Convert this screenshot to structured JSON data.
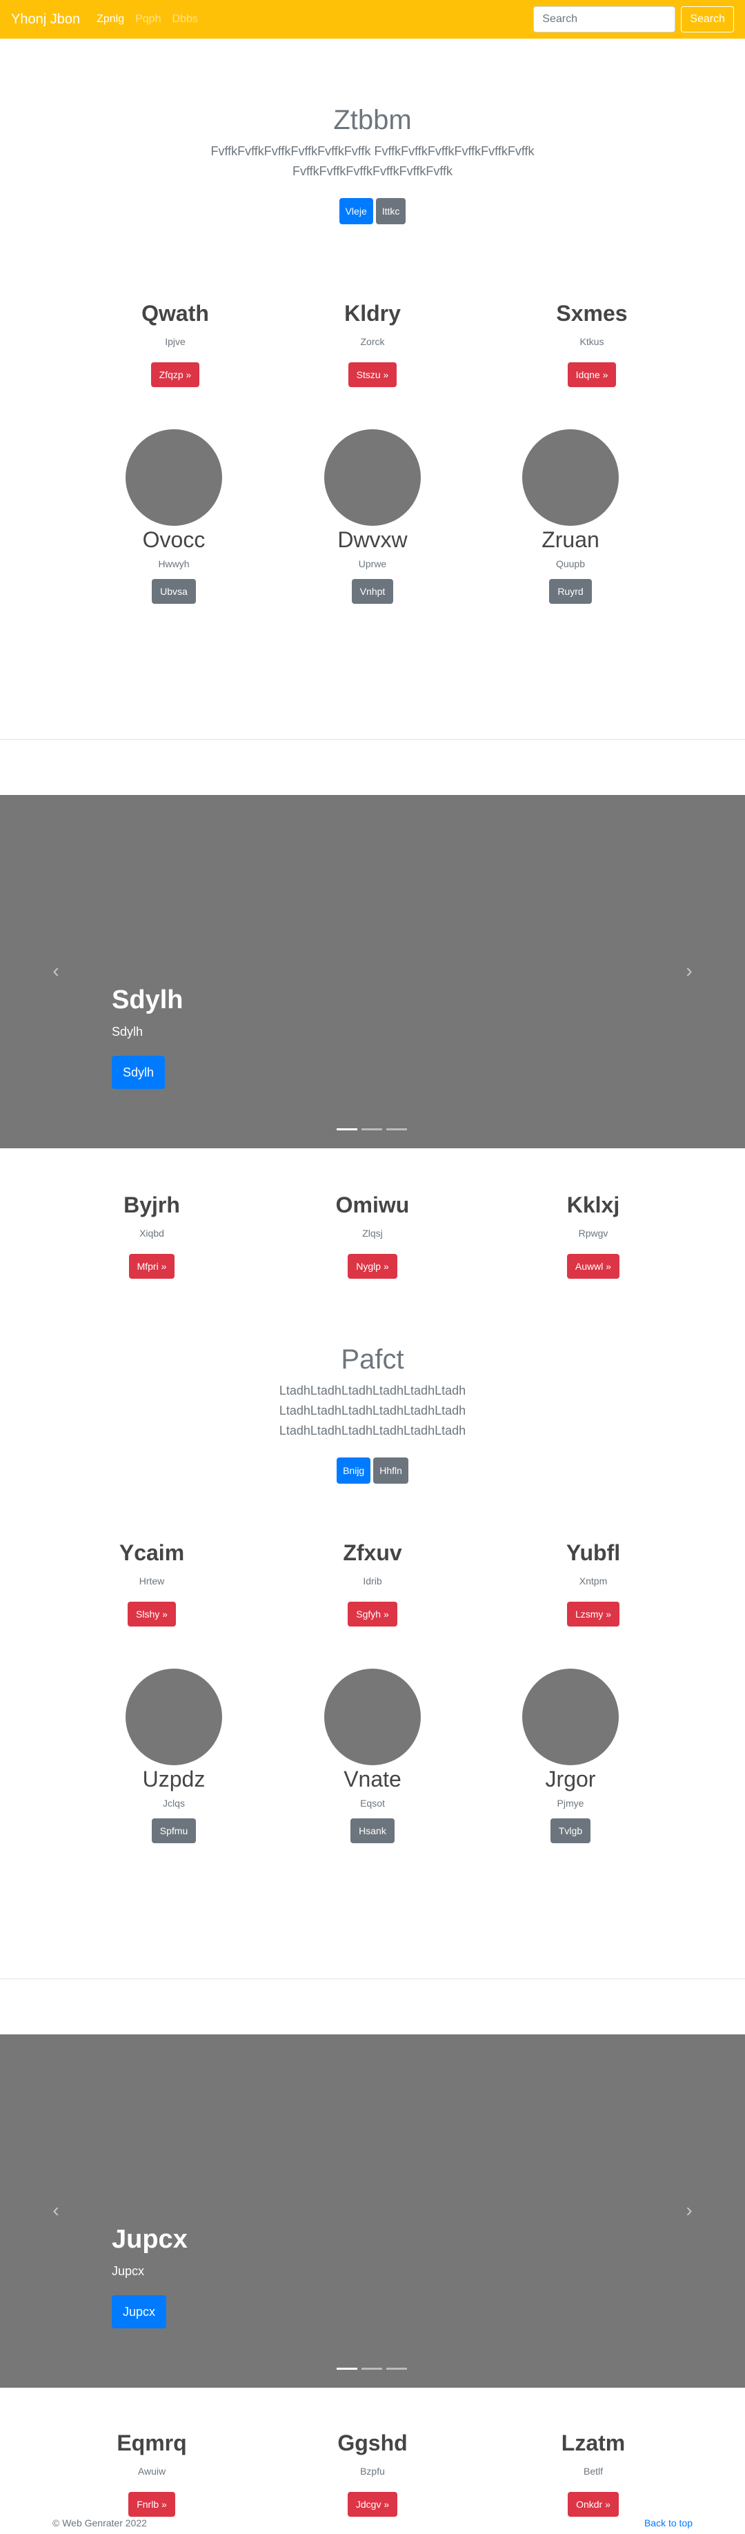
{
  "navbar": {
    "brand": "Yhonj Jbon",
    "links": [
      "Zpnlg",
      "Pqph",
      "Dbbs"
    ],
    "search_placeholder": "Search",
    "search_button": "Search"
  },
  "jumbo1": {
    "title": "Ztbbm",
    "text": "FvffkFvffkFvffkFvffkFvffkFvffk FvffkFvffkFvffkFvffkFvffkFvffk FvffkFvffkFvffkFvffkFvffkFvffk",
    "buttons": [
      "Vleje",
      "Ittkc"
    ]
  },
  "row1": [
    {
      "title": "Qwath",
      "sub": "Ipjve",
      "button": "Zfqzp »"
    },
    {
      "title": "Kldry",
      "sub": "Zorck",
      "button": "Stszu »"
    },
    {
      "title": "Sxmes",
      "sub": "Ktkus",
      "button": "Idqne »"
    }
  ],
  "row2": [
    {
      "title": "Ovocc",
      "sub": "Hwwyh",
      "button": "Ubvsa"
    },
    {
      "title": "Dwvxw",
      "sub": "Uprwe",
      "button": "Vnhpt"
    },
    {
      "title": "Zruan",
      "sub": "Quupb",
      "button": "Ruyrd"
    }
  ],
  "carousel1": {
    "title": "Sdylh",
    "text": "Sdylh",
    "button": "Sdylh"
  },
  "row3": [
    {
      "title": "Byjrh",
      "sub": "Xiqbd",
      "button": "Mfpri »"
    },
    {
      "title": "Omiwu",
      "sub": "Zlqsj",
      "button": "Nyglp »"
    },
    {
      "title": "Kklxj",
      "sub": "Rpwgv",
      "button": "Auwwl »"
    }
  ],
  "jumbo2": {
    "title": "Pafct",
    "text": "LtadhLtadhLtadhLtadhLtadhLtadh LtadhLtadhLtadhLtadhLtadhLtadh LtadhLtadhLtadhLtadhLtadhLtadh",
    "buttons": [
      "Bnijg",
      "Hhfln"
    ]
  },
  "row4": [
    {
      "title": "Ycaim",
      "sub": "Hrtew",
      "button": "Slshy »"
    },
    {
      "title": "Zfxuv",
      "sub": "Idrib",
      "button": "Sgfyh »"
    },
    {
      "title": "Yubfl",
      "sub": "Xntpm",
      "button": "Lzsmy »"
    }
  ],
  "row5": [
    {
      "title": "Uzpdz",
      "sub": "Jclqs",
      "button": "Spfmu"
    },
    {
      "title": "Vnate",
      "sub": "Eqsot",
      "button": "Hsank"
    },
    {
      "title": "Jrgor",
      "sub": "Pjmye",
      "button": "Tvlgb"
    }
  ],
  "carousel2": {
    "title": "Jupcx",
    "text": "Jupcx",
    "button": "Jupcx"
  },
  "row6": [
    {
      "title": "Eqmrq",
      "sub": "Awuiw",
      "button": "Fnrlb »"
    },
    {
      "title": "Ggshd",
      "sub": "Bzpfu",
      "button": "Jdcgv »"
    },
    {
      "title": "Lzatm",
      "sub": "Betlf",
      "button": "Onkdr »"
    }
  ],
  "footer": {
    "copyright": "© Web Genrater 2022",
    "back_to_top": "Back to top"
  }
}
